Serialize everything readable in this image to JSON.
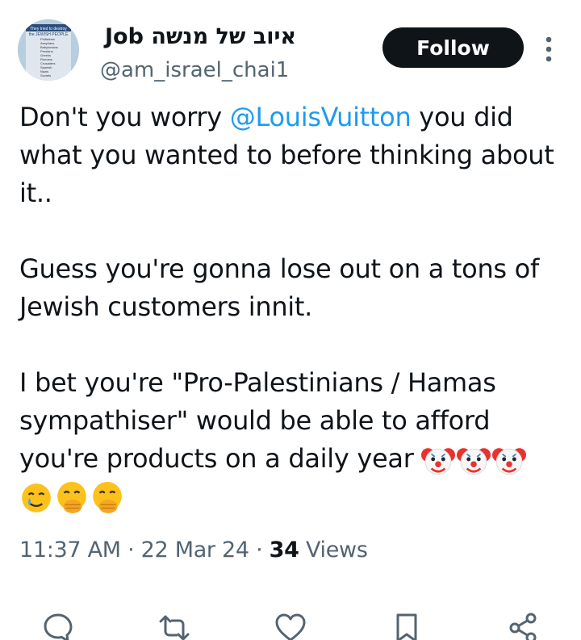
{
  "user": {
    "display_name": "איוב של מנשה Job",
    "handle": "@am_israel_chai1",
    "avatar_text": [
      "They tried to destroy",
      "the JEWISH PEOPLE",
      "Philistines",
      "Assyrians",
      "Babylonians",
      "Persians",
      "Greeks",
      "Romans",
      "Crusaders",
      "Spanish",
      "Nazis",
      "Soviets"
    ]
  },
  "header": {
    "follow_label": "Follow",
    "more_icon": "more-vertical-icon"
  },
  "tweet": {
    "line1_pre": "Don't you worry ",
    "mention": "@LouisVuitton",
    "line1_post": " you did what you wanted to before thinking about it..",
    "para2": "Guess you're gonna lose out on a tons of Jewish customers innit.",
    "para3": "I bet you're \"Pro-Palestinians / Hamas sympathiser\" would be able to afford you're products on a daily year ",
    "emojis_clown": [
      "clown-face",
      "clown-face",
      "clown-face"
    ],
    "emojis_end": [
      "smiling-face-with-tear",
      "face-with-hand-over-mouth",
      "face-with-hand-over-mouth"
    ]
  },
  "meta": {
    "time": "11:37 AM",
    "sep": "·",
    "date": "22 Mar 24",
    "views_count": "34",
    "views_label": "Views"
  },
  "actions": [
    "reply-icon",
    "retweet-icon",
    "like-icon",
    "bookmark-icon",
    "share-icon"
  ],
  "colors": {
    "link": "#1d9bf0",
    "muted": "#536471",
    "text": "#0f1419",
    "button_bg": "#0f1419"
  }
}
